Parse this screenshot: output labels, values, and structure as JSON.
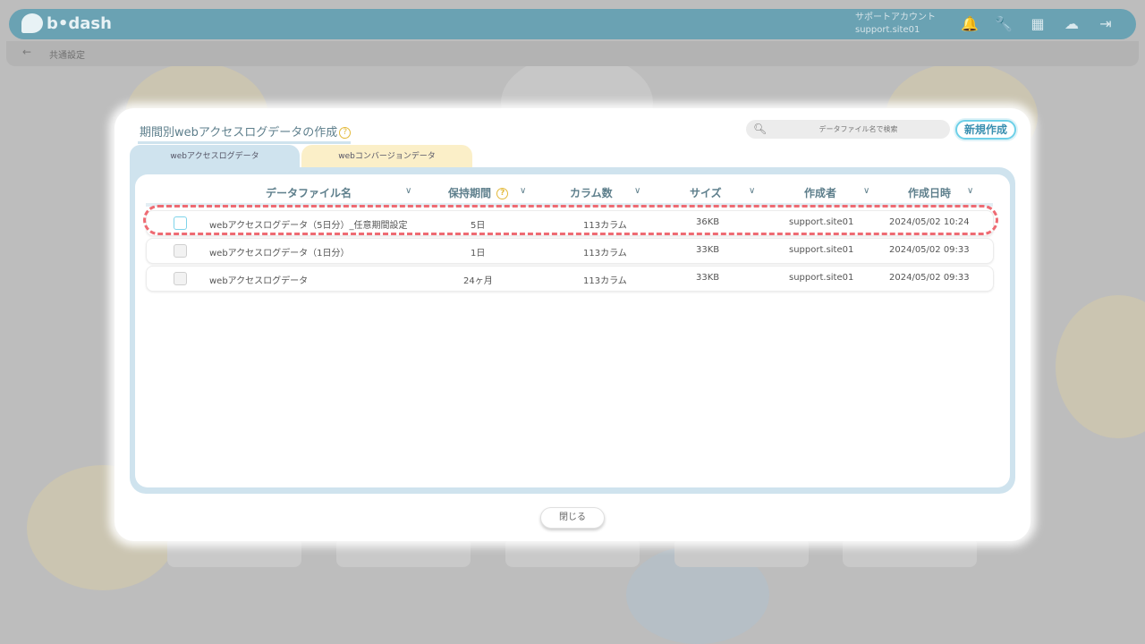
{
  "app": {
    "logo_text": "b•dash",
    "account_label": "サポートアカウント",
    "account_id": "support.site01",
    "breadcrumb": "共通設定"
  },
  "modal": {
    "title": "期間別webアクセスログデータの作成",
    "search_placeholder": "データファイル名で検索",
    "new_button": "新規作成",
    "tabs": [
      {
        "label": "webアクセスログデータ",
        "active": true
      },
      {
        "label": "webコンバージョンデータ",
        "active": false
      }
    ],
    "columns": {
      "name": "データファイル名",
      "retention": "保持期間",
      "columns_count": "カラム数",
      "size": "サイズ",
      "author": "作成者",
      "created": "作成日時"
    },
    "rows": [
      {
        "name": "webアクセスログデータ（5日分）_任意期間設定",
        "retention": "5日",
        "columns_count": "113カラム",
        "size": "36KB",
        "author": "support.site01",
        "created": "2024/05/02 10:24",
        "highlighted": true
      },
      {
        "name": "webアクセスログデータ（1日分）",
        "retention": "1日",
        "columns_count": "113カラム",
        "size": "33KB",
        "author": "support.site01",
        "created": "2024/05/02 09:33",
        "highlighted": false
      },
      {
        "name": "webアクセスログデータ",
        "retention": "24ヶ月",
        "columns_count": "113カラム",
        "size": "33KB",
        "author": "support.site01",
        "created": "2024/05/02 09:33",
        "highlighted": false
      }
    ],
    "close_button": "閉じる"
  },
  "colors": {
    "accent": "#6ed0e8",
    "header_text": "#5e7f8c",
    "highlight": "#ee6b73",
    "tab_access": "#cfe3ee",
    "tab_conversion": "#fbefc8"
  }
}
